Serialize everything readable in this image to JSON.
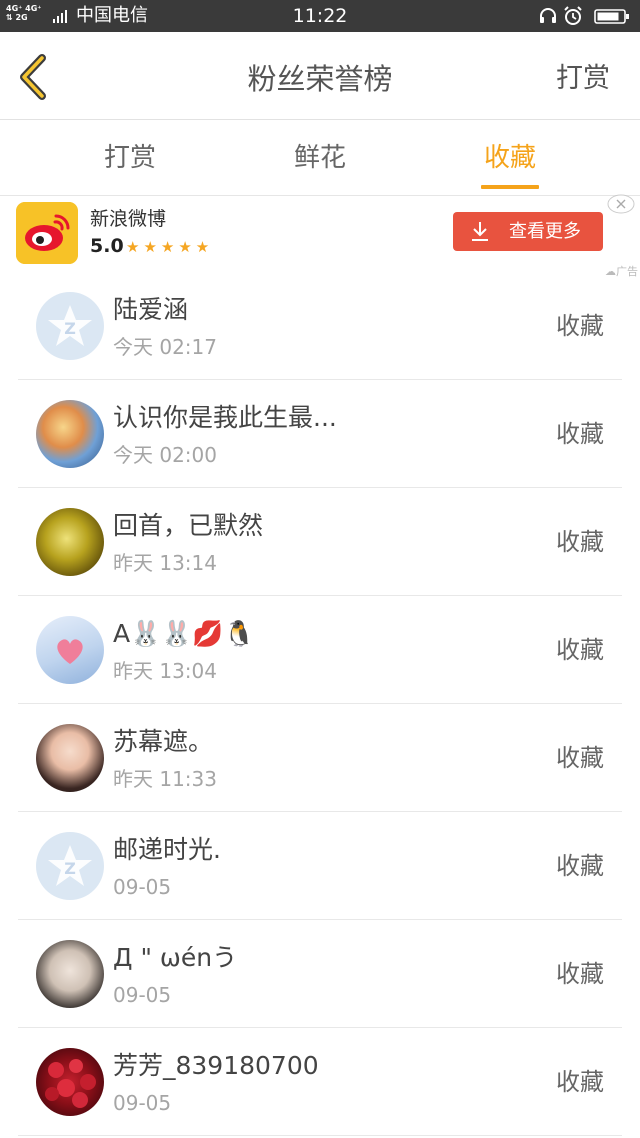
{
  "status_bar": {
    "network": "4G⁺ 4G⁺ 2G",
    "carrier": "中国电信",
    "time": "11:22"
  },
  "header": {
    "title": "粉丝荣誉榜",
    "action_label": "打赏"
  },
  "tabs": [
    {
      "label": "打赏",
      "active": false
    },
    {
      "label": "鲜花",
      "active": false
    },
    {
      "label": "收藏",
      "active": true
    }
  ],
  "ad": {
    "app_name": "新浪微博",
    "rating": "5.0",
    "stars": "★★★★★",
    "button_label": "查看更多",
    "tag": "广告"
  },
  "list": [
    {
      "name": "陆爱涵",
      "time": "今天 02:17",
      "type": "收藏"
    },
    {
      "name": "认识你是莪此生最...",
      "time": "今天 02:00",
      "type": "收藏"
    },
    {
      "name": "回首，已默然",
      "time": "昨天 13:14",
      "type": "收藏"
    },
    {
      "name": "A🐰🐰💋🐧",
      "time": "昨天 13:04",
      "type": "收藏"
    },
    {
      "name": "苏幕遮。",
      "time": "昨天 11:33",
      "type": "收藏"
    },
    {
      "name": "邮递时光.",
      "time": "09-05",
      "type": "收藏"
    },
    {
      "name": "Д \" ωénう",
      "time": "09-05",
      "type": "收藏"
    },
    {
      "name": "芳芳_839180700",
      "time": "09-05",
      "type": "收藏"
    }
  ],
  "colors": {
    "accent": "#f5a31a",
    "ad_button": "#e8533f",
    "status_bar": "#3a3a3a"
  }
}
